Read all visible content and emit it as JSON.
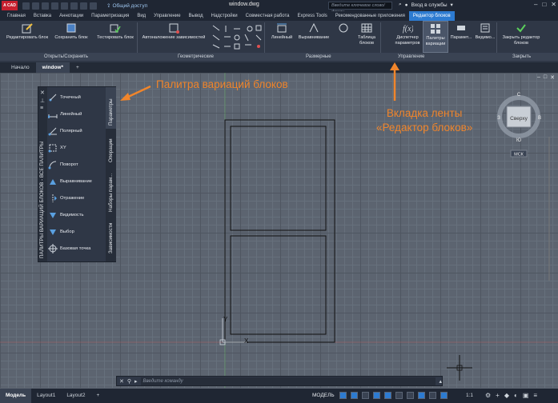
{
  "titlebar": {
    "logo": "A CAD",
    "share_label": "Общий доступ",
    "doc_title": "window.dwg",
    "search_placeholder": "Введите ключевое слово/фразу",
    "signin_label": "Вход в службы"
  },
  "menu_tabs": [
    {
      "label": "Главная"
    },
    {
      "label": "Вставка"
    },
    {
      "label": "Аннотации"
    },
    {
      "label": "Параметризация"
    },
    {
      "label": "Вид"
    },
    {
      "label": "Управление"
    },
    {
      "label": "Вывод"
    },
    {
      "label": "Надстройки"
    },
    {
      "label": "Совместная работа"
    },
    {
      "label": "Express Tools"
    },
    {
      "label": "Рекомендованные приложения"
    },
    {
      "label": "Редактор блоков"
    }
  ],
  "ribbon": {
    "edit_block": "Редактировать блок",
    "save_block": "Сохранить блок",
    "test_block": "Тестировать блок",
    "auto_constrain": "Автоналожение зависимостей",
    "linear": "Линейный",
    "align": "Выравнивание",
    "table_blocks": "Таблица блоков",
    "param_manager": "Диспетчер параметров",
    "palettes": "Палитры вариации",
    "params": "Парамет...",
    "visibility": "Видимо...",
    "close_editor": "Закрыть редактор блоков",
    "panels": {
      "open_save": "Открыть/Сохранить",
      "geometric": "Геометрические",
      "dimensional": "Размерные",
      "manage": "Управление",
      "close": "Закрыть"
    }
  },
  "doc_tabs": [
    {
      "label": "Начало"
    },
    {
      "label": "window*"
    }
  ],
  "palette": {
    "title": "ПАЛИТРЫ ВАРИАЦИЙ БЛОКОВ - ВСЕ ПАЛИТРЫ",
    "tools": [
      {
        "label": "Точечный"
      },
      {
        "label": "Линейный"
      },
      {
        "label": "Полярный"
      },
      {
        "label": "XY"
      },
      {
        "label": "Поворот"
      },
      {
        "label": "Выравнивание"
      },
      {
        "label": "Отражение"
      },
      {
        "label": "Видимость"
      },
      {
        "label": "Выбор"
      },
      {
        "label": "Базовая точка"
      }
    ],
    "tabs": [
      {
        "label": "Параметры"
      },
      {
        "label": "Операции"
      },
      {
        "label": "Наборы парам..."
      },
      {
        "label": "Зависимости"
      }
    ]
  },
  "annotations": {
    "palette_note": "Палитра вариаций блоков",
    "ribbon_note_1": "Вкладка ленты",
    "ribbon_note_2": "«Редактор блоков»"
  },
  "viewcube": {
    "top_label": "Сверху",
    "north": "С",
    "south": "Ю",
    "west": "З",
    "east": "В",
    "wcs": "МСК"
  },
  "axis": {
    "x": "X",
    "y": "Y"
  },
  "command": {
    "placeholder": "Введите команду"
  },
  "status": {
    "layouts": [
      {
        "label": "Модель"
      },
      {
        "label": "Layout1"
      },
      {
        "label": "Layout2"
      }
    ],
    "mode": "МОДЕЛЬ",
    "scale": "1:1"
  },
  "colors": {
    "accent": "#2d7bd1",
    "annotation": "#f0852b",
    "canvas": "#5c6470"
  }
}
